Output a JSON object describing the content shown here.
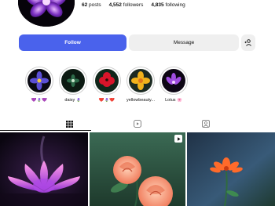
{
  "profile": {
    "avatar_icon": "purple-flower-avatar",
    "posts_count": "62",
    "posts_label": "posts",
    "followers_count": "4,552",
    "followers_label": "followers",
    "following_count": "4,835",
    "following_label": "following"
  },
  "actions": {
    "follow_label": "Follow",
    "message_label": "Message",
    "suggest_icon": "add-person-icon"
  },
  "highlights": [
    {
      "label": "💜🪻💜",
      "image": "blue-purple-flower"
    },
    {
      "label": "daisy 🪻",
      "image": "dark-green-flower"
    },
    {
      "label": "❤️🪻❤️",
      "image": "red-flower"
    },
    {
      "label": "yellowbeauty...",
      "image": "yellow-flower"
    },
    {
      "label": "Lotus 🌸",
      "image": "purple-lotus"
    }
  ],
  "tabs": [
    {
      "name": "posts",
      "icon": "grid-icon",
      "active": true
    },
    {
      "name": "reels",
      "icon": "reels-icon",
      "active": false
    },
    {
      "name": "tagged",
      "icon": "tagged-icon",
      "active": false
    }
  ],
  "posts": [
    {
      "image": "pink-lotus",
      "is_reel": false
    },
    {
      "image": "peach-roses",
      "is_reel": true,
      "reel_icon": "play-icon"
    },
    {
      "image": "orange-flower",
      "is_reel": false
    }
  ],
  "colors": {
    "follow_button": "#4a62ec",
    "secondary_button": "#efefef",
    "text": "#111111"
  }
}
